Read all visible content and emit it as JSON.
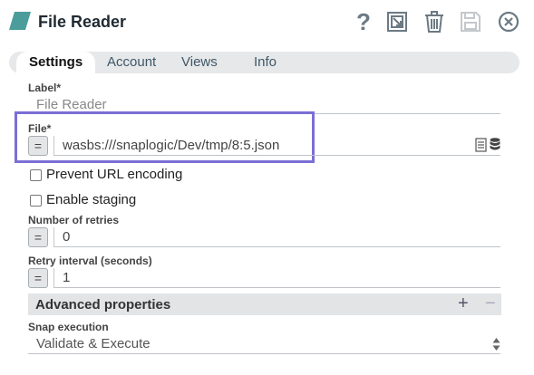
{
  "header": {
    "title": "File Reader",
    "icons": [
      "help-icon",
      "export-icon",
      "trash-icon",
      "save-icon",
      "close-icon"
    ],
    "accent": "#4a9d9a"
  },
  "tabs": [
    "Settings",
    "Account",
    "Views",
    "Info"
  ],
  "fields": {
    "label": {
      "label": "Label*",
      "value": "File Reader"
    },
    "file": {
      "label": "File*",
      "value": "wasbs:///snaplogic/Dev/tmp/8:5.json",
      "expr": "="
    },
    "prevent_url": {
      "label": "Prevent URL encoding",
      "checked": false
    },
    "staging": {
      "label": "Enable staging",
      "checked": false
    },
    "retries": {
      "label": "Number of retries",
      "value": "0",
      "expr": "="
    },
    "retry_interval": {
      "label": "Retry interval (seconds)",
      "value": "1",
      "expr": "="
    }
  },
  "advanced": {
    "title": "Advanced properties",
    "plus": "+",
    "minus": "−"
  },
  "snap_execution": {
    "label": "Snap execution",
    "value": "Validate & Execute"
  },
  "highlight_color": "#7b6fd6"
}
